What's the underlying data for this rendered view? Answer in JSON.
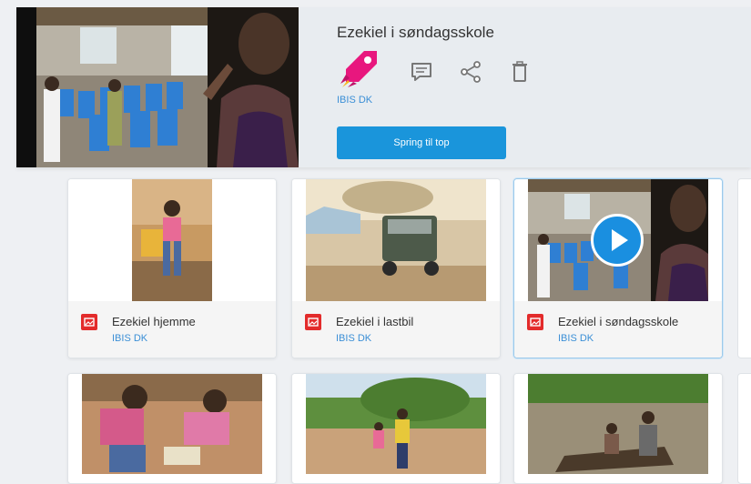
{
  "header": {
    "title": "Ezekiel i søndagsskole",
    "brand": "IBIS DK",
    "brand_logo_icon": "rocket-icon",
    "actions": [
      {
        "name": "comment",
        "icon": "comment-icon"
      },
      {
        "name": "share",
        "icon": "share-icon"
      },
      {
        "name": "delete",
        "icon": "trash-icon"
      }
    ],
    "jump_button": "Spring til top"
  },
  "cards": [
    {
      "title": "Ezekiel hjemme",
      "brand": "IBIS DK",
      "type_icon": "image-icon"
    },
    {
      "title": "Ezekiel i lastbil",
      "brand": "IBIS DK",
      "type_icon": "image-icon"
    },
    {
      "title": "Ezekiel i søndagsskole",
      "brand": "IBIS DK",
      "type_icon": "image-icon",
      "playing_icon": "play-icon"
    },
    {
      "title": "",
      "brand": "",
      "type_icon": "image-icon"
    },
    {
      "title": "",
      "brand": "",
      "type_icon": "image-icon"
    },
    {
      "title": "",
      "brand": "",
      "type_icon": "image-icon"
    }
  ],
  "colors": {
    "accent": "#1a95db",
    "brand_text": "#3b8fd6",
    "logo": "#e8177e",
    "type_icon": "#e32b2b"
  }
}
